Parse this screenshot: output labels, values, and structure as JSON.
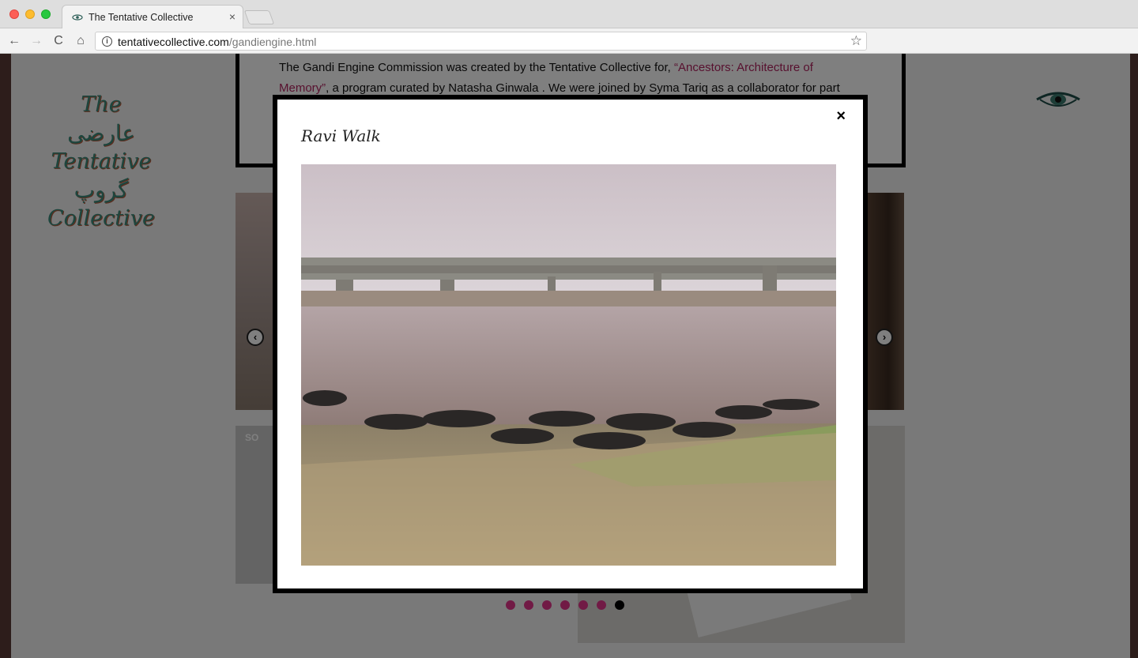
{
  "browser": {
    "tab_title": "The Tentative Collective",
    "tab_close": "×",
    "url_host": "tentativecollective.com",
    "url_path": "/gandiengine.html",
    "info_glyph": "i",
    "star_glyph": "☆",
    "back_glyph": "←",
    "forward_glyph": "→",
    "reload_glyph": "C",
    "home_glyph": "⌂"
  },
  "logo": {
    "line1": "The",
    "line2": "عارضی",
    "line3": "Tentative",
    "line4": "گروپ",
    "line5": "Collective"
  },
  "description": {
    "text_before": "The Gandi Engine Commission was created by the Tentative Collective for, ",
    "link_text": "“Ancestors: Architecture of Memory”",
    "text_after": ", a program curated by Natasha Ginwala . We were joined by Syma Tariq as a collaborator for part"
  },
  "carousel": {
    "prev_glyph": "‹",
    "next_glyph": "›",
    "dot_count": 7,
    "active_dot": 6
  },
  "soundcloud": {
    "label": "SO"
  },
  "modal": {
    "title": "Ravi Walk",
    "close_glyph": "×"
  },
  "icons": {
    "favicon": "eye-icon",
    "logo_eye": "eye-icon"
  },
  "colors": {
    "link": "#b0225e",
    "dot": "#e2358b",
    "dot_active": "#000000",
    "logo_text": "#3d8b7a"
  }
}
